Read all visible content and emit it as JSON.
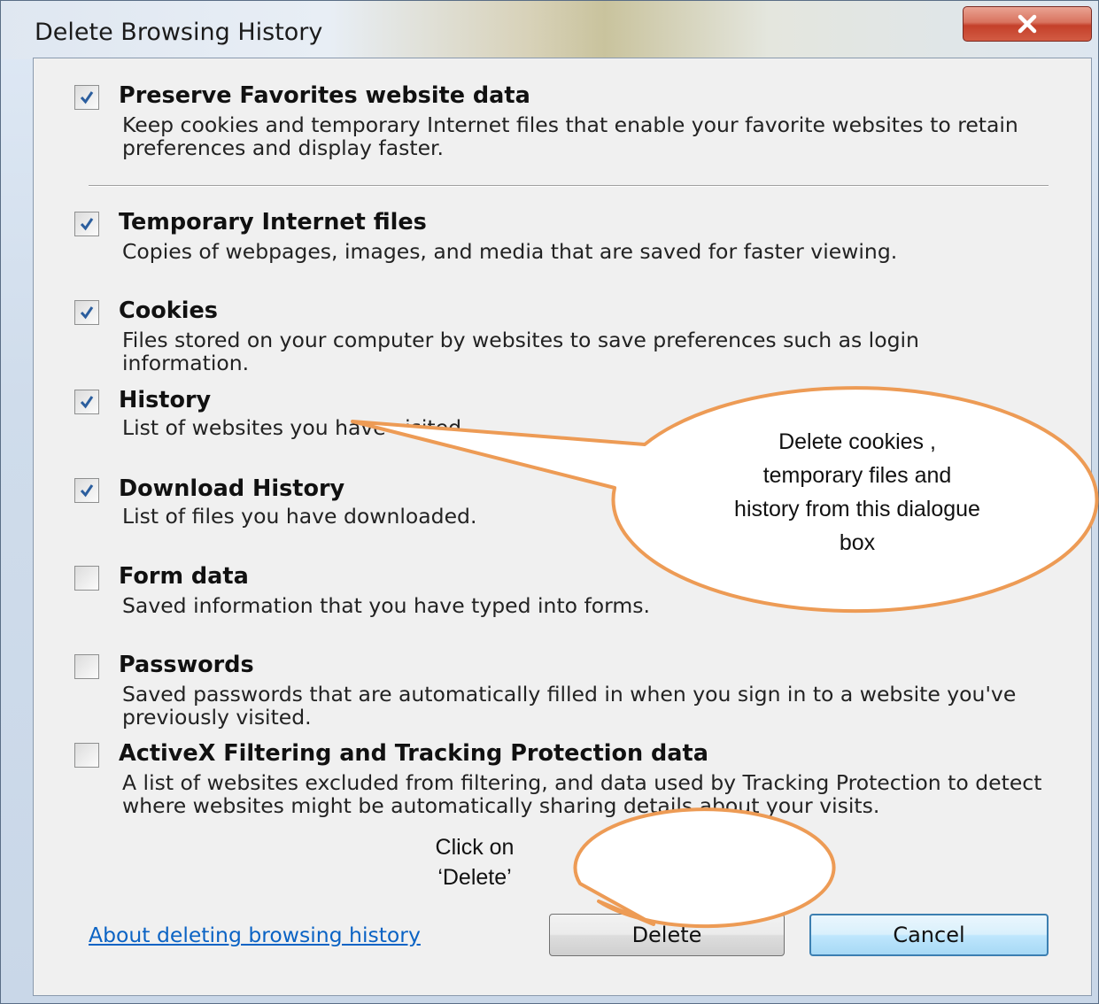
{
  "window": {
    "title": "Delete Browsing History"
  },
  "items": [
    {
      "title": "Preserve Favorites website data",
      "description": "Keep cookies and temporary Internet files that enable your favorite websites to retain preferences and display faster.",
      "checked": true
    },
    {
      "title": "Temporary Internet files",
      "description": "Copies of webpages, images, and media that are saved for faster viewing.",
      "checked": true
    },
    {
      "title": "Cookies",
      "description": "Files stored on your computer by websites to save preferences such as login information.",
      "checked": true
    },
    {
      "title": "History",
      "description": "List of websites you have visited.",
      "checked": true
    },
    {
      "title": "Download History",
      "description": "List of files you have downloaded.",
      "checked": true
    },
    {
      "title": "Form data",
      "description": "Saved information that you have typed into forms.",
      "checked": false
    },
    {
      "title": "Passwords",
      "description": "Saved passwords that are automatically filled in when you sign in to a website you've previously visited.",
      "checked": false
    },
    {
      "title": "ActiveX Filtering and Tracking Protection data",
      "description": "A list of websites excluded from filtering, and data used by Tracking Protection to detect where websites might be automatically sharing details about your visits.",
      "checked": false
    }
  ],
  "footer": {
    "about_link": "About deleting browsing history",
    "delete_label": "Delete",
    "cancel_label": "Cancel"
  },
  "callouts": {
    "main": "Delete cookies , temporary files and history from this dialogue box",
    "main_lines": [
      "Delete cookies ,",
      "temporary files and",
      "history from this dialogue",
      "box"
    ],
    "delete_lines": [
      "Click on",
      "‘Delete’"
    ]
  },
  "colors": {
    "callout_stroke": "#ed9b55",
    "link": "#0b63c4",
    "checkmark": "#2b5e9e"
  }
}
